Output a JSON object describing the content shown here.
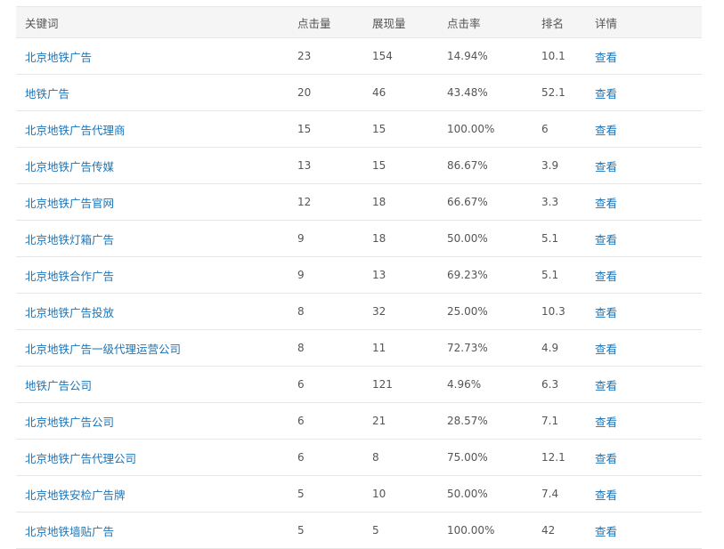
{
  "table": {
    "headers": {
      "keyword": "关键词",
      "clicks": "点击量",
      "impressions": "展现量",
      "ctr": "点击率",
      "rank": "排名",
      "detail": "详情"
    },
    "rows": [
      {
        "keyword": "北京地铁广告",
        "clicks": "23",
        "impressions": "154",
        "ctr": "14.94%",
        "rank": "10.1",
        "detail": "查看"
      },
      {
        "keyword": "地铁广告",
        "clicks": "20",
        "impressions": "46",
        "ctr": "43.48%",
        "rank": "52.1",
        "detail": "查看"
      },
      {
        "keyword": "北京地铁广告代理商",
        "clicks": "15",
        "impressions": "15",
        "ctr": "100.00%",
        "rank": "6",
        "detail": "查看"
      },
      {
        "keyword": "北京地铁广告传媒",
        "clicks": "13",
        "impressions": "15",
        "ctr": "86.67%",
        "rank": "3.9",
        "detail": "查看"
      },
      {
        "keyword": "北京地铁广告官网",
        "clicks": "12",
        "impressions": "18",
        "ctr": "66.67%",
        "rank": "3.3",
        "detail": "查看"
      },
      {
        "keyword": "北京地铁灯箱广告",
        "clicks": "9",
        "impressions": "18",
        "ctr": "50.00%",
        "rank": "5.1",
        "detail": "查看"
      },
      {
        "keyword": "北京地铁合作广告",
        "clicks": "9",
        "impressions": "13",
        "ctr": "69.23%",
        "rank": "5.1",
        "detail": "查看"
      },
      {
        "keyword": "北京地铁广告投放",
        "clicks": "8",
        "impressions": "32",
        "ctr": "25.00%",
        "rank": "10.3",
        "detail": "查看"
      },
      {
        "keyword": "北京地铁广告一级代理运营公司",
        "clicks": "8",
        "impressions": "11",
        "ctr": "72.73%",
        "rank": "4.9",
        "detail": "查看"
      },
      {
        "keyword": "地铁广告公司",
        "clicks": "6",
        "impressions": "121",
        "ctr": "4.96%",
        "rank": "6.3",
        "detail": "查看"
      },
      {
        "keyword": "北京地铁广告公司",
        "clicks": "6",
        "impressions": "21",
        "ctr": "28.57%",
        "rank": "7.1",
        "detail": "查看"
      },
      {
        "keyword": "北京地铁广告代理公司",
        "clicks": "6",
        "impressions": "8",
        "ctr": "75.00%",
        "rank": "12.1",
        "detail": "查看"
      },
      {
        "keyword": "北京地铁安检广告牌",
        "clicks": "5",
        "impressions": "10",
        "ctr": "50.00%",
        "rank": "7.4",
        "detail": "查看"
      },
      {
        "keyword": "北京地铁墙贴广告",
        "clicks": "5",
        "impressions": "5",
        "ctr": "100.00%",
        "rank": "42",
        "detail": "查看"
      }
    ]
  }
}
